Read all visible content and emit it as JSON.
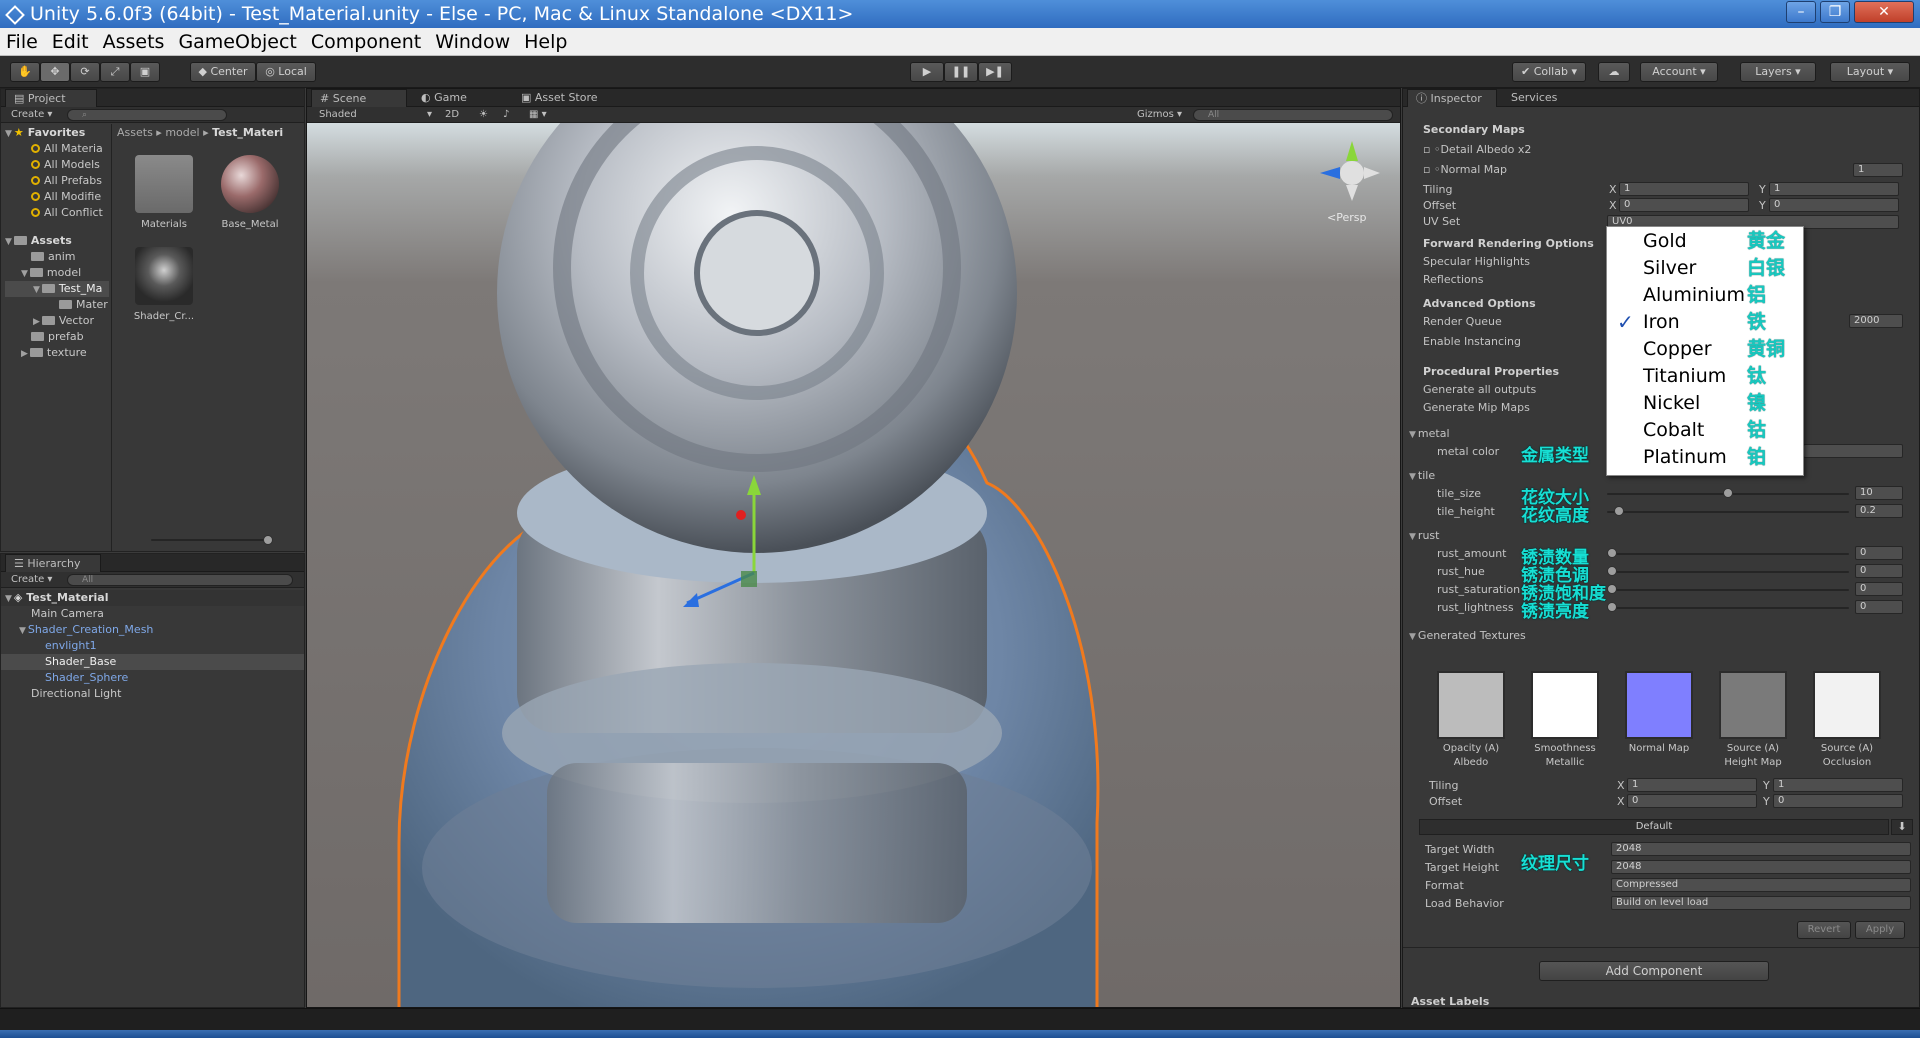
{
  "window": {
    "title": "Unity 5.6.0f3 (64bit) - Test_Material.unity - Else - PC, Mac & Linux Standalone <DX11>",
    "controls": [
      "–",
      "❐",
      "✕"
    ]
  },
  "menu": [
    "File",
    "Edit",
    "Assets",
    "GameObject",
    "Component",
    "Window",
    "Help"
  ],
  "toolbar": {
    "tools": [
      "hand",
      "move",
      "rotate",
      "scale",
      "rect"
    ],
    "pivot": "Center",
    "space": "Local",
    "play": "▶",
    "pause": "❚❚",
    "step": "▶❚",
    "collab": "Collab",
    "account": "Account",
    "layers": "Layers",
    "layout": "Layout"
  },
  "project": {
    "tab": "Project",
    "create": "Create",
    "favorites_label": "Favorites",
    "favorites": [
      "All Materia",
      "All Models",
      "All Prefabs",
      "All Modifie",
      "All Conflict"
    ],
    "assets_label": "Assets",
    "assets_tree": [
      "anim",
      "model",
      "Test_Ma",
      "Mater",
      "Vector",
      "prefab",
      "texture"
    ],
    "breadcrumb": [
      "Assets",
      "model",
      "Test_Materi"
    ],
    "items": [
      "Materials",
      "Base_Metal",
      "Shader_Cr..."
    ]
  },
  "hierarchy": {
    "tab": "Hierarchy",
    "create": "Create",
    "search_placeholder": "All",
    "scene": "Test_Material",
    "items": [
      "Main Camera",
      "Shader_Creation_Mesh",
      "envlight1",
      "Shader_Base",
      "Shader_Sphere",
      "Directional Light"
    ]
  },
  "scene_view": {
    "tabs": [
      "Scene",
      "Game",
      "Asset Store"
    ],
    "shading": "Shaded",
    "mode_2d": "2D",
    "gizmos": "Gizmos",
    "search_placeholder": "All",
    "persp": "Persp"
  },
  "inspector": {
    "tabs": [
      "Inspector",
      "Services"
    ],
    "secondary_maps": "Secondary Maps",
    "detail_albedo": "Detail Albedo x2",
    "normal_map": "Normal Map",
    "normal_map_value": "1",
    "tiling": "Tiling",
    "offset": "Offset",
    "tiling_x": "1",
    "tiling_y": "1",
    "offset_x": "0",
    "offset_y": "0",
    "uv_set": "UV Set",
    "uv_set_value": "UV0",
    "forward_options": "Forward Rendering Options",
    "specular_highlights": "Specular Highlights",
    "reflections": "Reflections",
    "advanced_options": "Advanced Options",
    "render_queue": "Render Queue",
    "render_queue_value": "2000",
    "enable_instancing": "Enable Instancing",
    "procedural_properties": "Procedural Properties",
    "generate_all": "Generate all outputs",
    "generate_mip": "Generate Mip Maps",
    "group_metal": "metal",
    "metal_color": "metal color",
    "group_tile": "tile",
    "tile_size": "tile_size",
    "tile_size_value": "10",
    "tile_size_fraction": 0.5,
    "tile_height": "tile_height",
    "tile_height_value": "0.2",
    "tile_height_fraction": 0.05,
    "group_rust": "rust",
    "rust_amount": "rust_amount",
    "rust_hue": "rust_hue",
    "rust_saturation": "rust_saturation",
    "rust_lightness": "rust_lightness",
    "rust_values": [
      "0",
      "0",
      "0",
      "0"
    ],
    "generated_textures": "Generated Textures",
    "textures": [
      {
        "label": "Opacity (A)",
        "sub": "Albedo",
        "color": "#bcbcbc"
      },
      {
        "label": "Smoothness",
        "sub": "Metallic",
        "color": "#ffffff"
      },
      {
        "label": "Normal Map",
        "sub": "",
        "color": "#7f7fff"
      },
      {
        "label": "Source (A)",
        "sub": "Height Map",
        "color": "#7a7a7a"
      },
      {
        "label": "Source (A)",
        "sub": "Occlusion",
        "color": "#f2f2f2"
      }
    ],
    "tex_tiling_x": "1",
    "tex_tiling_y": "1",
    "tex_offset_x": "0",
    "tex_offset_y": "0",
    "default_label": "Default",
    "target_width": "Target Width",
    "target_width_value": "2048",
    "target_height": "Target Height",
    "target_height_value": "2048",
    "format": "Format",
    "format_value": "Compressed",
    "load_behavior": "Load Behavior",
    "load_behavior_value": "Build on level load",
    "revert": "Revert",
    "apply": "Apply",
    "add_component": "Add Component",
    "asset_labels": "Asset Labels"
  },
  "dropdown": {
    "items": [
      {
        "en": "Gold",
        "cn": "黄金"
      },
      {
        "en": "Silver",
        "cn": "白银"
      },
      {
        "en": "Aluminium",
        "cn": "铝"
      },
      {
        "en": "Iron",
        "cn": "铁"
      },
      {
        "en": "Copper",
        "cn": "黄铜"
      },
      {
        "en": "Titanium",
        "cn": "钛"
      },
      {
        "en": "Nickel",
        "cn": "镍"
      },
      {
        "en": "Cobalt",
        "cn": "钴"
      },
      {
        "en": "Platinum",
        "cn": "铂"
      }
    ],
    "selected": "Iron",
    "check": "✓"
  },
  "annotations": {
    "metal_color": "金属类型",
    "tile_size": "花纹大小",
    "tile_height": "花纹高度",
    "rust_amount": "锈渍数量",
    "rust_hue": "锈渍色调",
    "rust_saturation": "锈渍饱和度",
    "rust_lightness": "锈渍亮度",
    "target_size": "纹理尺寸"
  },
  "colors": {
    "selection_outline": "#f07a1e",
    "annotation": "#17dfd4",
    "title_bar": "#3a78c8",
    "panel_bg": "#383838"
  }
}
